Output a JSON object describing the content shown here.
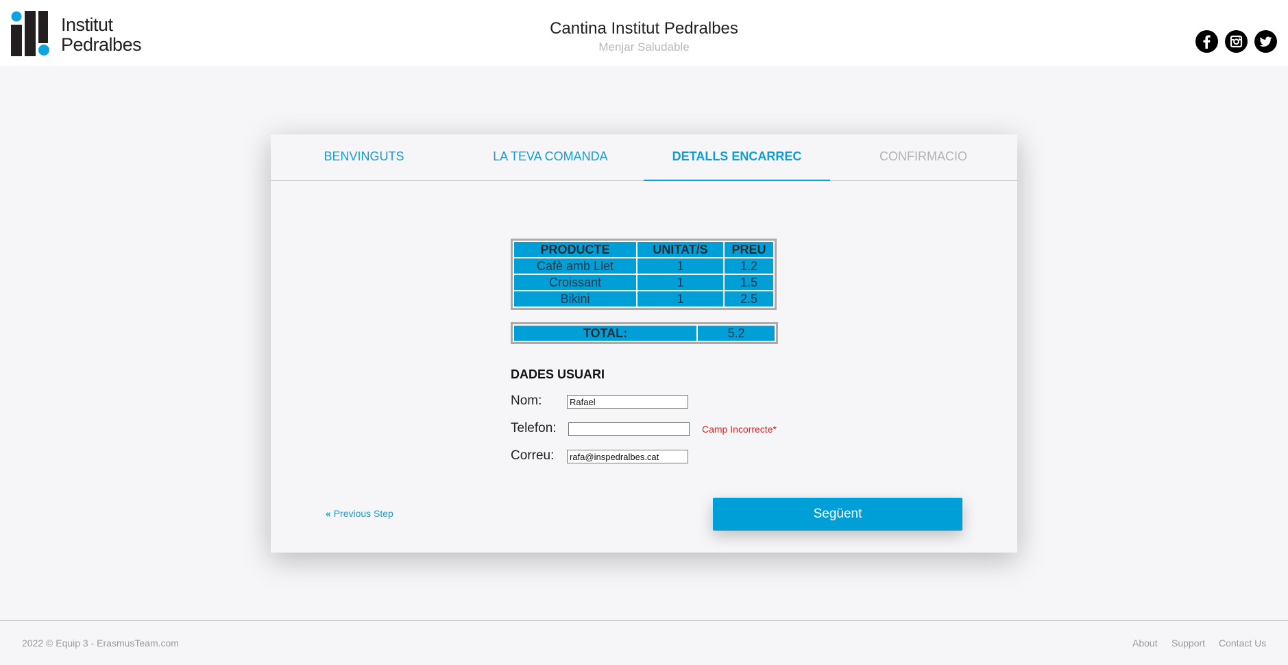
{
  "header": {
    "logo_line1": "Institut",
    "logo_line2": "Pedralbes",
    "title": "Cantina Institut Pedralbes",
    "subtitle": "Menjar Saludable",
    "social": [
      "facebook-icon",
      "instagram-icon",
      "twitter-icon"
    ]
  },
  "tabs": [
    {
      "label": "BENVINGUTS",
      "state": "done"
    },
    {
      "label": "LA TEVA COMANDA",
      "state": "done"
    },
    {
      "label": "DETALLS ENCARREC",
      "state": "active"
    },
    {
      "label": "CONFIRMACIO",
      "state": "pending"
    }
  ],
  "order": {
    "headers": [
      "PRODUCTE",
      "UNITAT/S",
      "PREU"
    ],
    "rows": [
      [
        "Cafè amb Llet",
        "1",
        "1.2"
      ],
      [
        "Croissant",
        "1",
        "1.5"
      ],
      [
        "Bikini",
        "1",
        "2.5"
      ]
    ],
    "total_label": "TOTAL:",
    "total_value": "5.2"
  },
  "user": {
    "section_title": "DADES USUARI",
    "name_label": "Nom:",
    "name_value": "Rafael",
    "phone_label": "Telefon:",
    "phone_value": "",
    "phone_error": "Camp Incorrecte*",
    "email_label": "Correu:",
    "email_value": "rafa@inspedralbes.cat"
  },
  "nav": {
    "previous": "Previous Step",
    "next": "Següent"
  },
  "footer": {
    "copyright": "2022 © Equip 3 - ErasmusTeam.com",
    "links": [
      "About",
      "Support",
      "Contact Us"
    ]
  },
  "colors": {
    "accent": "#0b9fd6",
    "table_fill": "#009fd8",
    "error": "#e02020"
  }
}
